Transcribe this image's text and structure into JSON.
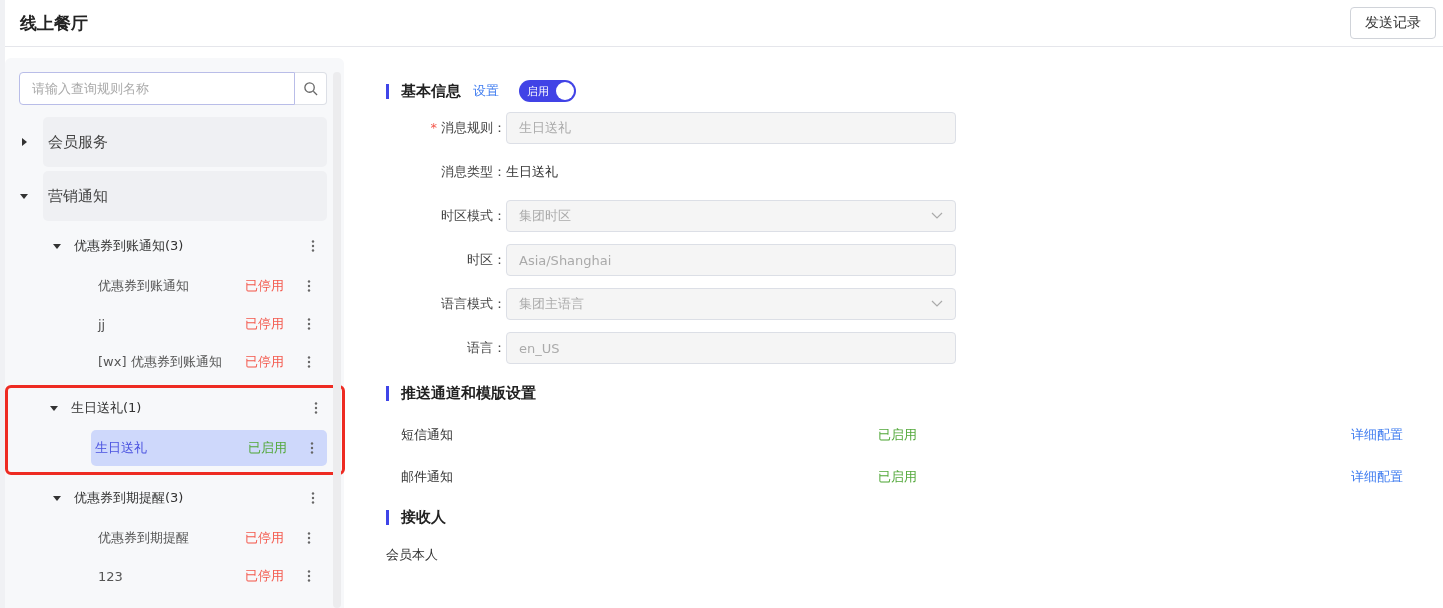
{
  "header": {
    "title": "线上餐厅",
    "button": "发送记录"
  },
  "sidebar": {
    "search": {
      "placeholder": "请输入查询规则名称"
    },
    "tree": [
      {
        "label": "会员服务",
        "expanded": false
      },
      {
        "label": "营销通知",
        "expanded": true,
        "children": [
          {
            "label": "优惠券到账通知(3)",
            "expanded": true,
            "highlighted": false,
            "children": [
              {
                "label": "优惠券到账通知",
                "status": "已停用",
                "enabled": false,
                "selected": false
              },
              {
                "label": "jj",
                "status": "已停用",
                "enabled": false,
                "selected": false
              },
              {
                "label": "[wx] 优惠券到账通知",
                "status": "已停用",
                "enabled": false,
                "selected": false
              }
            ]
          },
          {
            "label": "生日送礼(1)",
            "expanded": true,
            "highlighted": true,
            "children": [
              {
                "label": "生日送礼",
                "status": "已启用",
                "enabled": true,
                "selected": true
              }
            ]
          },
          {
            "label": "优惠券到期提醒(3)",
            "expanded": true,
            "highlighted": false,
            "children": [
              {
                "label": "优惠券到期提醒",
                "status": "已停用",
                "enabled": false,
                "selected": false
              },
              {
                "label": "123",
                "status": "已停用",
                "enabled": false,
                "selected": false
              }
            ]
          }
        ]
      }
    ]
  },
  "basic_info": {
    "title": "基本信息",
    "link": "设置",
    "toggle": {
      "label": "启用",
      "on": true
    },
    "fields": [
      {
        "kind": "input",
        "label": "消息规则：",
        "required_mark": "*",
        "value": "生日送礼",
        "disabled": true
      },
      {
        "kind": "text",
        "label": "消息类型：",
        "value": "生日送礼"
      },
      {
        "kind": "select",
        "label": "时区模式：",
        "value": "集团时区",
        "disabled": true
      },
      {
        "kind": "input",
        "label": "时区：",
        "value": "Asia/Shanghai",
        "disabled": true
      },
      {
        "kind": "select",
        "label": "语言模式：",
        "value": "集团主语言",
        "disabled": true
      },
      {
        "kind": "input",
        "label": "语言：",
        "value": "en_US",
        "disabled": true
      }
    ]
  },
  "channels": {
    "title": "推送通道和模版设置",
    "rows": [
      {
        "name": "短信通知",
        "status": "已启用",
        "enabled": true,
        "action": "详细配置"
      },
      {
        "name": "邮件通知",
        "status": "已启用",
        "enabled": true,
        "action": "详细配置"
      }
    ]
  },
  "recipients": {
    "title": "接收人",
    "value": "会员本人"
  }
}
